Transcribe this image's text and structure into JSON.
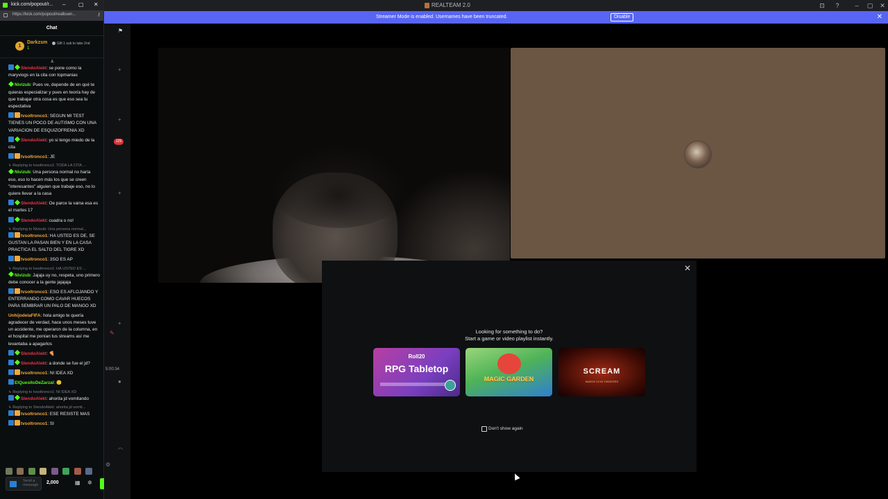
{
  "titlebar": {
    "title": "REALTEAM 2.0",
    "controls": [
      "⊡",
      "?",
      "–",
      "▢",
      "✕"
    ]
  },
  "banner": {
    "message": "Streamer Mode is enabled. Usernames have been truncated.",
    "disable_label": "Disable",
    "close": "✕"
  },
  "popout": {
    "window_title": "kick.com/popout/r...",
    "controls": [
      "–",
      "▢",
      "✕"
    ],
    "url": "https://kick.com/popout/realbuen...",
    "chat_label": "Chat",
    "pinned": {
      "user": "Darkzsm",
      "sub_count": "1",
      "coin": "1",
      "gift_text": "Gift 1 sub to take 2nd"
    },
    "input_placeholder": "Send a message",
    "points": "2,000",
    "messages": [
      {
        "badges": [
          "blue",
          "green"
        ],
        "user": "SlendoAlekt",
        "color": "#e8364a",
        "text": "se pone como la maryviogs en la cita con topmanias"
      },
      {
        "badges": [
          "green"
        ],
        "user": "Nivizub",
        "color": "#53fc18",
        "text": "Pues ve, depende de en qué te quieras especializar y pues en teoría hay de que trabajar otra cosa es que eso sea tu espectativa"
      },
      {
        "badges": [
          "blue",
          "orange"
        ],
        "user": "tvsoltronco1",
        "color": "#f2a83b",
        "text": "SEGUN MI TEST TIENES UN POCO DE AUTISMO CON UNA VARIACION DE ESQUIZOFRENIA XD"
      },
      {
        "badges": [
          "blue",
          "green"
        ],
        "user": "SlendoAlekt",
        "color": "#e8364a",
        "text": "yo si tengo miedo de la cita"
      },
      {
        "badges": [
          "blue",
          "orange"
        ],
        "user": "tvsoltronco1",
        "color": "#f2a83b",
        "text": "JE"
      },
      {
        "reply": "Replying to tvsoltronco1: TODA LA CITA ...",
        "badges": [
          "green"
        ],
        "user": "Nivizub",
        "color": "#53fc18",
        "text": "Una persona normal no haría eso, eso lo hacen más los que se creen \"interesantes\" alguien que trabaje eso, no lo quiere llevar a la casa"
      },
      {
        "badges": [
          "blue",
          "green"
        ],
        "user": "SlendoAlekt",
        "color": "#e8364a",
        "text": "Oe parce la vaina esa es el martes 17"
      },
      {
        "badges": [
          "blue",
          "green"
        ],
        "user": "SlendoAlekt",
        "color": "#e8364a",
        "text": "cuadra o no!"
      },
      {
        "reply": "Replying to Nivizub: Una persona normal...",
        "badges": [
          "blue",
          "orange"
        ],
        "user": "tvsoltronco1",
        "color": "#f2a83b",
        "text": "HA USTED ES DE, SE GUSTAN LA PASAN BIEN Y EN LA CASA PRACTICA EL SALTO DEL TIGRE XD"
      },
      {
        "badges": [
          "blue",
          "orange"
        ],
        "user": "tvsoltronco1",
        "color": "#f2a83b",
        "text": "3SO ES AP"
      },
      {
        "reply": "Replying to tvsoltronco1: HA USTED ES ...",
        "badges": [
          "green"
        ],
        "user": "Nivizub",
        "color": "#53fc18",
        "text": "Jajaja uy no, respeta, uno primero debe conocer a la gente jajajaja"
      },
      {
        "badges": [
          "blue",
          "orange"
        ],
        "user": "tvsoltronco1",
        "color": "#f2a83b",
        "text": "ESO ES AFLOJANDO Y ENTERRANDO COMO CAVAR HUECOS PARA SEMBRAR UN PALO DE MANGO XD"
      },
      {
        "badges": [],
        "user": "UnhijodelaFIFA",
        "color": "#f2a83b",
        "text": "hola amigo te quería agradecer de verdad, hace unos meses tuve un accidente, me operaron de la columna, en el hospital me ponían tus streams así me levantaba a apagarlos"
      },
      {
        "badges": [
          "blue",
          "green"
        ],
        "user": "SlendoAlekt",
        "color": "#e8364a",
        "text": "🍕"
      },
      {
        "badges": [
          "blue",
          "green"
        ],
        "user": "SlendoAlekt",
        "color": "#e8364a",
        "text": "a donde se fue el jd?"
      },
      {
        "badges": [
          "blue",
          "orange"
        ],
        "user": "tvsoltronco1",
        "color": "#f2a83b",
        "text": "NI IDEA XD"
      },
      {
        "badges": [
          "blue"
        ],
        "user": "ElQuesitoDeZarzal",
        "color": "#53fc18",
        "text": "🙂"
      },
      {
        "reply": "Replying to tvsoltronco1: NI IDEA XD",
        "badges": [
          "blue",
          "green"
        ],
        "user": "SlendoAlekt",
        "color": "#e8364a",
        "text": "ahorita jd vomitando"
      },
      {
        "reply": "Replying to SlendoAlekt: ahorita jd vomit...",
        "badges": [
          "blue",
          "orange"
        ],
        "user": "tvsoltronco1",
        "color": "#f2a83b",
        "text": "ESE RESISTE MAS"
      },
      {
        "badges": [
          "blue",
          "orange"
        ],
        "user": "tvsoltronco1",
        "color": "#f2a83b",
        "text": "SI"
      }
    ]
  },
  "rail": {
    "mention_count": "129",
    "timer": "5:00:34"
  },
  "activity": {
    "close": "✕",
    "heading_line1": "Looking for something to do?",
    "heading_line2": "Start a game or video playlist instantly.",
    "cards": [
      {
        "brand": "Roll20",
        "title": "RPG Tabletop"
      },
      {
        "title": "MAGIC GARDEN"
      },
      {
        "title": "SCREAM",
        "subtitle": "MARCH 10 IN THEATERS"
      }
    ],
    "dont_show": "Don't show again"
  }
}
